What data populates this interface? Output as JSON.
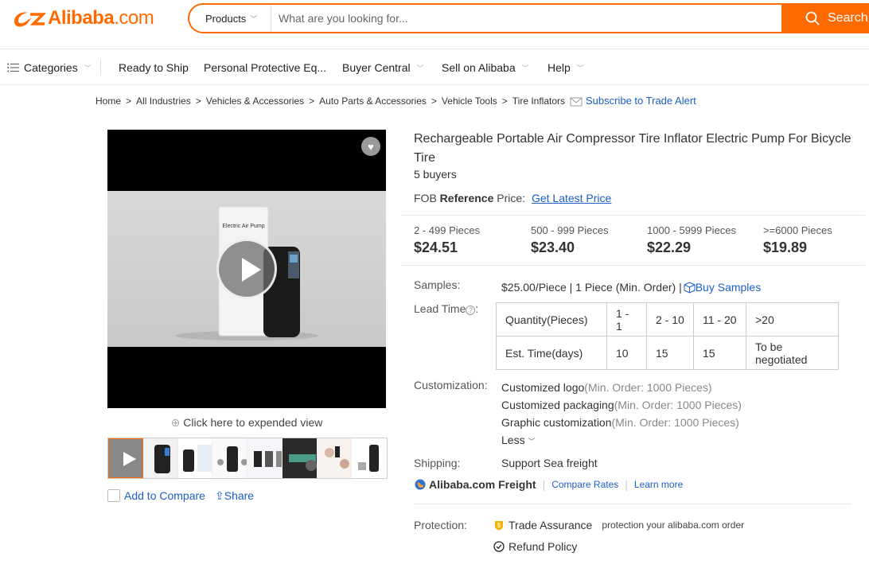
{
  "header": {
    "logo": {
      "brand": "Alibaba",
      "suffix": ".com"
    },
    "search": {
      "category": "Products",
      "placeholder": "What are you looking for...",
      "button_label": "Search"
    }
  },
  "nav": {
    "categories": "Categories",
    "ready_to_ship": "Ready to Ship",
    "ppe": "Personal Protective Eq...",
    "buyer_central": "Buyer Central",
    "sell": "Sell on Alibaba",
    "help": "Help"
  },
  "breadcrumb": {
    "items": [
      "Home",
      "All Industries",
      "Vehicles & Accessories",
      "Auto Parts & Accessories",
      "Vehicle Tools",
      "Tire Inflators"
    ],
    "alert": "Subscribe to Trade Alert"
  },
  "gallery": {
    "expand_label": "Click here to expended view",
    "compare_label": "Add to Compare",
    "share_label": "Share",
    "product_box_text": "Electric Air Pump"
  },
  "product": {
    "title": "Rechargeable Portable Air Compressor Tire Inflator Electric Pump For Bicycle Tire",
    "buyers": "5 buyers",
    "fob_prefix": "FOB",
    "fob_bold": "Reference",
    "fob_suffix": "Price:",
    "fob_link": "Get Latest Price"
  },
  "tiers": [
    {
      "qty": "2 - 499 Pieces",
      "price": "$24.51"
    },
    {
      "qty": "500 - 999 Pieces",
      "price": "$23.40"
    },
    {
      "qty": "1000 - 5999 Pieces",
      "price": "$22.29"
    },
    {
      "qty": ">=6000 Pieces",
      "price": "$19.89"
    }
  ],
  "samples": {
    "label": "Samples:",
    "text": "$25.00/Piece | 1 Piece (Min. Order) |",
    "link": "Buy Samples"
  },
  "lead_time": {
    "label": "Lead Time",
    "label_suffix": ":",
    "rows": [
      [
        "Quantity(Pieces)",
        "1 - 1",
        "2 - 10",
        "11 - 20",
        ">20"
      ],
      [
        "Est. Time(days)",
        "10",
        "15",
        "15",
        "To be negotiated"
      ]
    ]
  },
  "customization": {
    "label": "Customization:",
    "items": [
      {
        "name": "Customized logo",
        "moq": "(Min. Order: 1000 Pieces)"
      },
      {
        "name": "Customized packaging",
        "moq": "(Min. Order: 1000 Pieces)"
      },
      {
        "name": "Graphic customization",
        "moq": "(Min. Order: 1000 Pieces)"
      }
    ],
    "less": "Less"
  },
  "shipping": {
    "label": "Shipping:",
    "value": "Support Sea freight",
    "freight_name": "Alibaba.com Freight",
    "compare_rates": "Compare Rates",
    "learn_more": "Learn more"
  },
  "protection": {
    "label": "Protection:",
    "trade_assurance": "Trade Assurance",
    "trade_sub": "protection your alibaba.com order",
    "refund": "Refund Policy"
  },
  "colors": {
    "brand": "#ff6a00",
    "link": "#1a5fc8"
  }
}
